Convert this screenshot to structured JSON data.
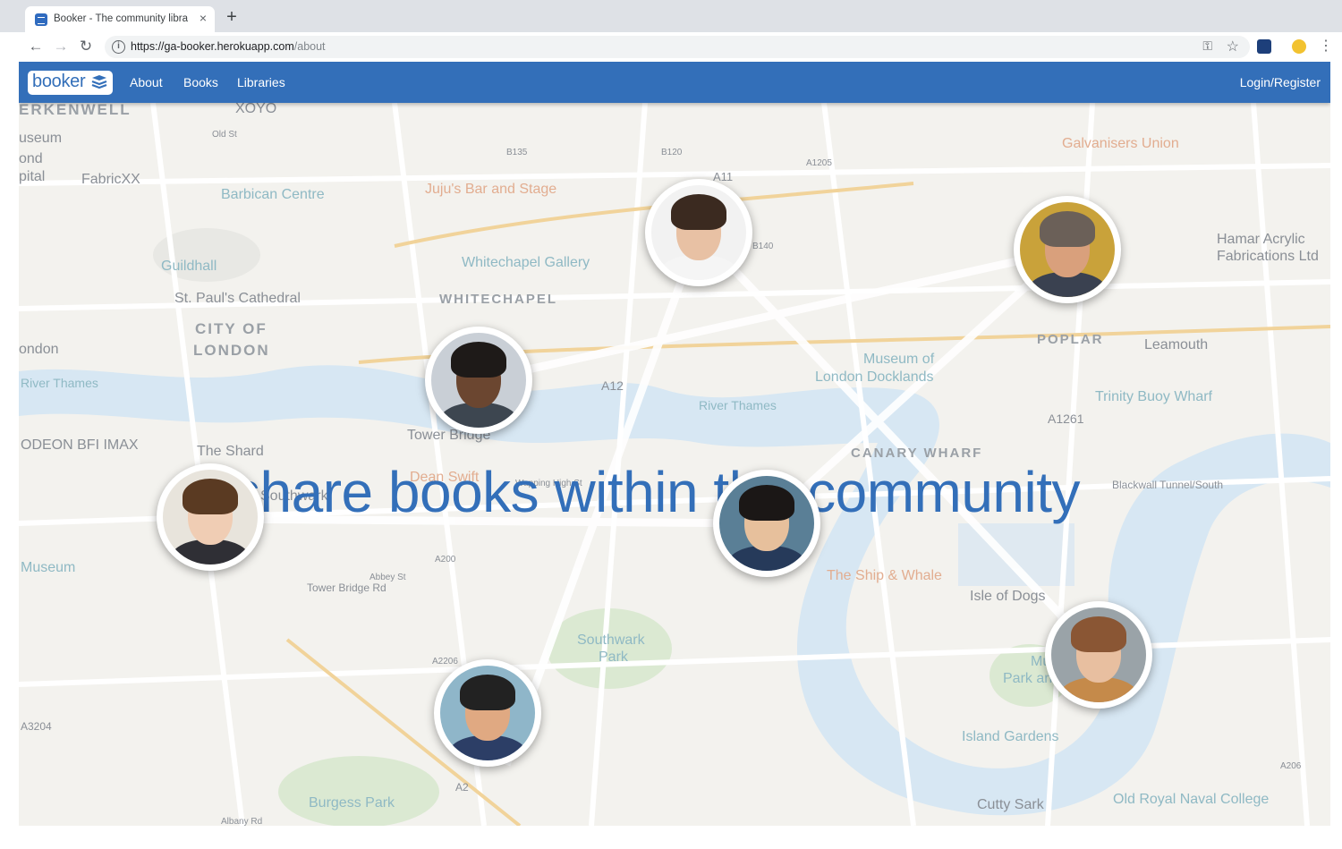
{
  "browser": {
    "tab_title": "Booker - The community library",
    "tab_close_glyph": "×",
    "new_tab_glyph": "+",
    "back_glyph": "←",
    "forward_glyph": "→",
    "reload_glyph": "↻",
    "info_glyph": "i",
    "url_host": "https://ga-booker.herokuapp.com",
    "url_path": "/about",
    "key_glyph": "⚿",
    "star_glyph": "☆",
    "menu_glyph": "⋮"
  },
  "navbar": {
    "brand": "booker",
    "links": [
      "About",
      "Books",
      "Libraries"
    ],
    "login": "Login/Register",
    "color": "#336fb9"
  },
  "hero": {
    "headline": "share books within the community"
  },
  "map_labels": [
    {
      "text": "ERKENWELL",
      "cls": "district"
    },
    {
      "text": "XOYO",
      "cls": ""
    },
    {
      "text": "Old St",
      "cls": "road"
    },
    {
      "text": "B135",
      "cls": "road"
    },
    {
      "text": "B120",
      "cls": "road"
    },
    {
      "text": "A1205",
      "cls": "road"
    },
    {
      "text": "Galvanisers Union",
      "cls": "poi-orange"
    },
    {
      "text": "useum",
      "cls": ""
    },
    {
      "text": "ond",
      "cls": ""
    },
    {
      "text": "pital",
      "cls": ""
    },
    {
      "text": "FabricXX",
      "cls": ""
    },
    {
      "text": "Barbican Centre",
      "cls": "poi"
    },
    {
      "text": "Juju's Bar and Stage",
      "cls": "poi-orange"
    },
    {
      "text": "A11",
      "cls": "road"
    },
    {
      "text": "Hamar Acrylic",
      "cls": ""
    },
    {
      "text": "Fabrications Ltd",
      "cls": ""
    },
    {
      "text": "Guildhall",
      "cls": "poi"
    },
    {
      "text": "Whitechapel Gallery",
      "cls": "poi"
    },
    {
      "text": "B140",
      "cls": "road"
    },
    {
      "text": "St. Paul's Cathedral",
      "cls": ""
    },
    {
      "text": "WHITECHAPEL",
      "cls": "district"
    },
    {
      "text": "CITY OF",
      "cls": "district"
    },
    {
      "text": "LONDON",
      "cls": "district"
    },
    {
      "text": "POPLAR",
      "cls": "district"
    },
    {
      "text": "Leamouth",
      "cls": ""
    },
    {
      "text": "ondon",
      "cls": ""
    },
    {
      "text": "Museum of",
      "cls": "poi"
    },
    {
      "text": "London Docklands",
      "cls": "poi"
    },
    {
      "text": "River Thames",
      "cls": "poi"
    },
    {
      "text": "A12",
      "cls": "road"
    },
    {
      "text": "River Thames",
      "cls": "poi"
    },
    {
      "text": "Trinity Buoy Wharf",
      "cls": "poi"
    },
    {
      "text": "A1261",
      "cls": "road"
    },
    {
      "text": "ODEON BFI IMAX",
      "cls": ""
    },
    {
      "text": "The Shard",
      "cls": ""
    },
    {
      "text": "Tower Bridge",
      "cls": ""
    },
    {
      "text": "Dean Swift",
      "cls": "poi-orange"
    },
    {
      "text": "Wapping High St",
      "cls": "road"
    },
    {
      "text": "CANARY WHARF",
      "cls": "district"
    },
    {
      "text": "Blackwall Tunnel/South",
      "cls": "road"
    },
    {
      "text": "Southwark",
      "cls": ""
    },
    {
      "text": "Museum",
      "cls": "poi"
    },
    {
      "text": "Abbey St",
      "cls": "road"
    },
    {
      "text": "A200",
      "cls": "road"
    },
    {
      "text": "The Ship & Whale",
      "cls": "poi-orange"
    },
    {
      "text": "Isle of Dogs",
      "cls": ""
    },
    {
      "text": "Tower Bridge Rd",
      "cls": "road"
    },
    {
      "text": "Southwark",
      "cls": "poi"
    },
    {
      "text": "Park",
      "cls": "poi"
    },
    {
      "text": "A2206",
      "cls": "road"
    },
    {
      "text": "Mudchute",
      "cls": "poi"
    },
    {
      "text": "Park and Farm",
      "cls": "poi"
    },
    {
      "text": "Island Gardens",
      "cls": "poi"
    },
    {
      "text": "A3204",
      "cls": "road"
    },
    {
      "text": "A2",
      "cls": "road"
    },
    {
      "text": "Burgess Park",
      "cls": "poi"
    },
    {
      "text": "Cutty Sark",
      "cls": ""
    },
    {
      "text": "Old Royal Naval College",
      "cls": "poi"
    },
    {
      "text": "Albany Rd",
      "cls": "road"
    },
    {
      "text": "A206",
      "cls": "road"
    }
  ],
  "avatars": [
    {
      "skin": "#e8c1a4",
      "hair": "#3b2a20",
      "bg": "#f2f2f2",
      "body": "#f5f5f5"
    },
    {
      "skin": "#d9a07c",
      "hair": "#6b6058",
      "bg": "#c9a23a",
      "body": "#3a4150"
    },
    {
      "skin": "#6b4630",
      "hair": "#1e1a18",
      "bg": "#c9cfd6",
      "body": "#3d4650"
    },
    {
      "skin": "#f0cdb4",
      "hair": "#5a3a22",
      "bg": "#e8e4dc",
      "body": "#2f2f35"
    },
    {
      "skin": "#e7c09c",
      "hair": "#1b1716",
      "bg": "#5a7f96",
      "body": "#263a5a"
    },
    {
      "skin": "#e8bfa0",
      "hair": "#8a5634",
      "bg": "#9aa3a8",
      "body": "#c58a4a"
    },
    {
      "skin": "#e0a982",
      "hair": "#222222",
      "bg": "#8fb6c9",
      "body": "#2c3e66"
    }
  ]
}
